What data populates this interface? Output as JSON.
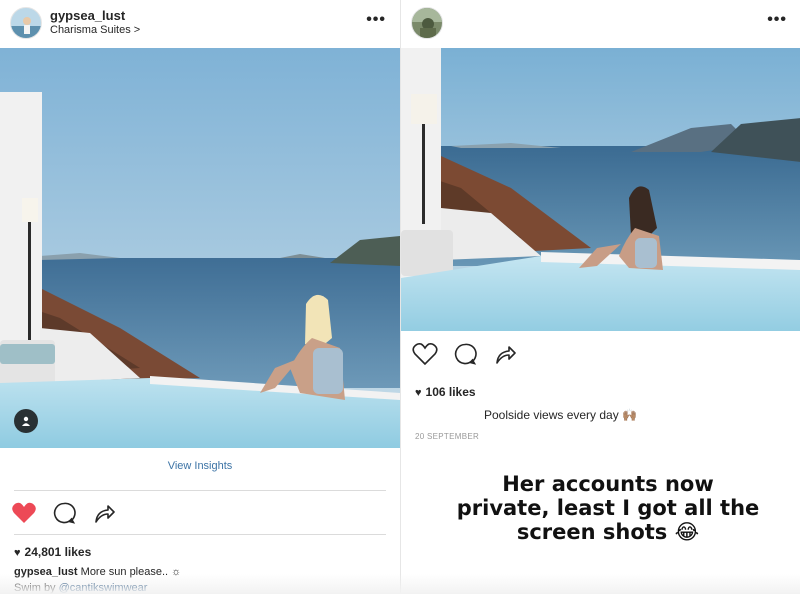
{
  "left_post": {
    "username": "gypsea_lust",
    "location": "Charisma Suites >",
    "more": "•••",
    "view_insights": "View Insights",
    "likes": "24,801 likes",
    "caption_user": "gypsea_lust",
    "caption_text": "More sun please.. ☼",
    "caption_line2_prefix": "Swim by ",
    "caption_mention": "@cantikswimwear",
    "liked": true,
    "heart_color": "#ed4956"
  },
  "right_post": {
    "more": "•••",
    "likes": "106 likes",
    "caption": "Poolside views every day 🙌🏽",
    "date": "20 SEPTEMBER"
  },
  "overlay": {
    "text": "Her accounts now private, least I got all the screen shots 😂"
  },
  "icons": {
    "heart_filled": "heart-icon",
    "comment": "comment-icon",
    "share": "share-icon",
    "user_tag": "user-icon",
    "more": "more-icon"
  }
}
